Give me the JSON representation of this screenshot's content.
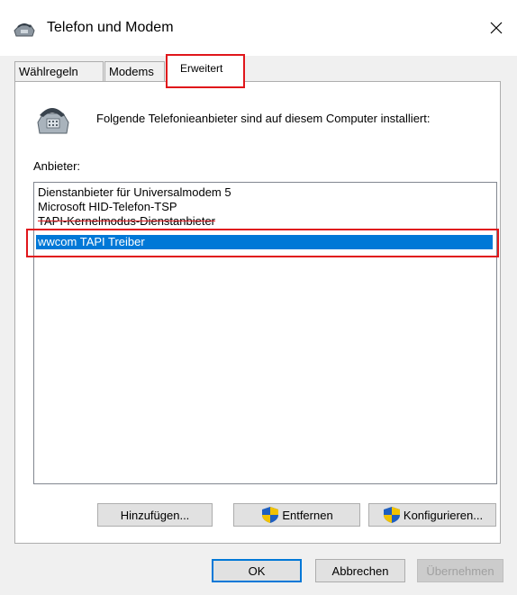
{
  "window": {
    "title": "Telefon und Modem",
    "close_icon": "close-icon"
  },
  "tabs": [
    {
      "label": "Wählregeln",
      "active": false
    },
    {
      "label": "Modems",
      "active": false
    },
    {
      "label": "Erweitert",
      "active": true
    }
  ],
  "content": {
    "intro": "Folgende Telefonieanbieter sind auf diesem Computer installiert:",
    "providers_label": "Anbieter:",
    "providers": [
      {
        "label": "Dienstanbieter für Universalmodem 5",
        "selected": false
      },
      {
        "label": "Microsoft HID-Telefon-TSP",
        "selected": false
      },
      {
        "label": "TAPI-Kernelmodus-Dienstanbieter",
        "selected": false
      },
      {
        "label": "wwcom TAPI Treiber",
        "selected": true
      }
    ]
  },
  "buttons": {
    "add": "Hinzufügen...",
    "remove": "Entfernen",
    "configure": "Konfigurieren...",
    "ok": "OK",
    "cancel": "Abbrechen",
    "apply": "Übernehmen"
  },
  "colors": {
    "selection": "#0078d7",
    "highlight_outline": "#e0161b"
  }
}
